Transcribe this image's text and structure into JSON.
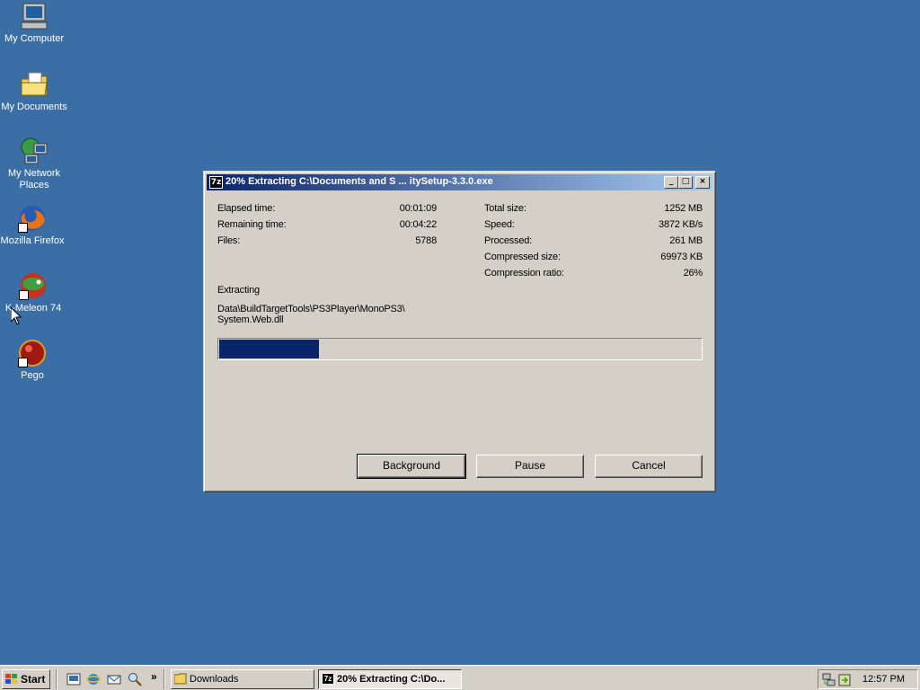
{
  "desktop": {
    "icons": [
      {
        "label": "My Computer",
        "icon": "my-computer-icon"
      },
      {
        "label": "My Documents",
        "icon": "my-documents-icon"
      },
      {
        "label": "My Network Places",
        "icon": "network-places-icon"
      },
      {
        "label": "Mozilla Firefox",
        "icon": "firefox-icon"
      },
      {
        "label": "K-Meleon 74",
        "icon": "kmeleon-icon"
      },
      {
        "label": "Pego",
        "icon": "pego-icon"
      }
    ],
    "background_color": "#3a6ea5"
  },
  "window": {
    "app_icon": "7z",
    "title": "20% Extracting C:\\Documents and S ... itySetup-3.3.0.exe",
    "controls": {
      "minimize": "_",
      "maximize": "□",
      "close": "×"
    },
    "stats_left": [
      {
        "label": "Elapsed time:",
        "value": "00:01:09"
      },
      {
        "label": "Remaining time:",
        "value": "00:04:22"
      },
      {
        "label": "Files:",
        "value": "5788"
      }
    ],
    "stats_right": [
      {
        "label": "Total size:",
        "value": "1252 MB"
      },
      {
        "label": "Speed:",
        "value": "3872 KB/s"
      },
      {
        "label": "Processed:",
        "value": "261 MB"
      },
      {
        "label": "Compressed size:",
        "value": "69973 KB"
      },
      {
        "label": "Compression ratio:",
        "value": "26%"
      }
    ],
    "status_label": "Extracting",
    "current_file_line1": "Data\\BuildTargetTools\\PS3Player\\MonoPS3\\",
    "current_file_line2": "System.Web.dll",
    "progress_fraction": 0.21,
    "buttons": {
      "background": "Background",
      "pause": "Pause",
      "cancel": "Cancel"
    },
    "title_gradient": [
      "#0a246a",
      "#a6caf0"
    ]
  },
  "taskbar": {
    "start_label": "Start",
    "quicklaunch_more": "»",
    "tasks": [
      {
        "label": "Downloads",
        "active": false
      },
      {
        "label": "20% Extracting C:\\Do...",
        "active": true
      }
    ],
    "clock": "12:57 PM"
  }
}
